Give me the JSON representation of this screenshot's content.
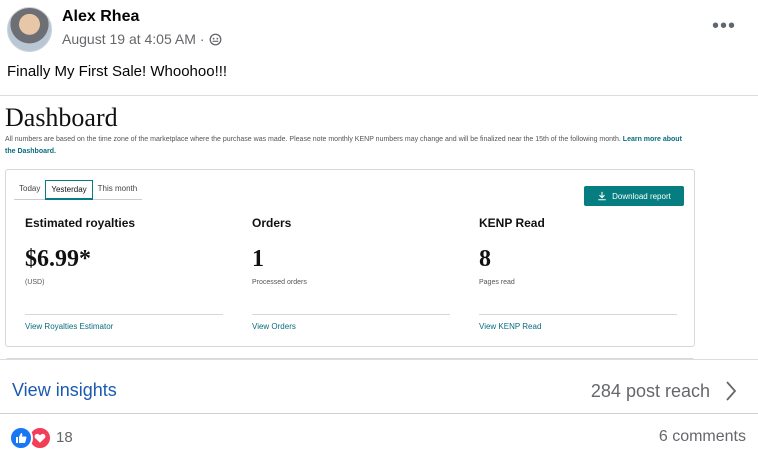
{
  "post": {
    "author": "Alex Rhea",
    "timestamp": "August 19 at 4:05 AM",
    "separator": "·",
    "audience_icon": "public-globe-icon",
    "more_icon": "•••",
    "text": "Finally My First Sale!  Whoohoo!!!"
  },
  "dashboard": {
    "title": "Dashboard",
    "note": "All numbers are based on the time zone of the marketplace where the purchase was made. Please note monthly KENP numbers may change and will be finalized near the 15th of the following month.",
    "learn_more": "Learn more about the Dashboard.",
    "tabs": [
      "Today",
      "Yesterday",
      "This month"
    ],
    "active_tab": "Yesterday",
    "download_label": "Download report",
    "accent_color": "#067d80",
    "metrics": [
      {
        "label": "Estimated royalties",
        "value": "$6.99*",
        "sub": "(USD)",
        "link": "View Royalties Estimator"
      },
      {
        "label": "Orders",
        "value": "1",
        "sub": "Processed orders",
        "link": "View Orders"
      },
      {
        "label": "KENP Read",
        "value": "8",
        "sub": "Pages read",
        "link": "View KENP Read"
      }
    ]
  },
  "insights": {
    "label": "View insights",
    "reach": "284 post reach"
  },
  "engagement": {
    "reaction_count": "18",
    "comments": "6 comments",
    "reaction_icons": [
      "like-icon",
      "love-icon"
    ]
  }
}
